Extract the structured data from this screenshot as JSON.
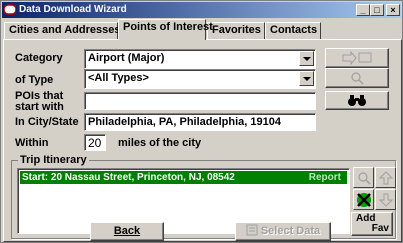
{
  "window": {
    "title": "Data Download Wizard",
    "minimize": "_",
    "maximize": "□",
    "close": "×"
  },
  "tabs": [
    {
      "label": "Cities and Addresses",
      "active": false
    },
    {
      "label": "Points of Interest",
      "active": true
    },
    {
      "label": "Favorites",
      "active": false
    },
    {
      "label": "Contacts",
      "active": false
    }
  ],
  "form": {
    "category_label": "Category",
    "category_value": "Airport (Major)",
    "type_label_line1": "of Type",
    "type_value": "<All Types>",
    "pois_label_line1": "POIs that",
    "pois_label_line2": "start with",
    "pois_value": "",
    "city_label": "In City/State",
    "city_value": "Philadelphia, PA, Philadelphia, 19104",
    "within_label": "Within",
    "within_value": "20",
    "within_suffix": "miles of the city"
  },
  "side_buttons": {
    "find_glyph": "🔍",
    "binoculars": "🔭"
  },
  "itinerary": {
    "group_title": "Trip Itinerary",
    "rows": [
      {
        "text": "Start: 20 Nassau Street, Princeton, NJ, 08542",
        "tag": "Report"
      }
    ],
    "add_fav_line1": "Add",
    "add_fav_line2": "Fav"
  },
  "footer": {
    "back_label": "Back",
    "select_label": "Select Data"
  },
  "colors": {
    "title_start": "#0a246a",
    "title_end": "#a6caf0",
    "itinerary_highlight": "#008000",
    "face": "#d4d0c8"
  }
}
